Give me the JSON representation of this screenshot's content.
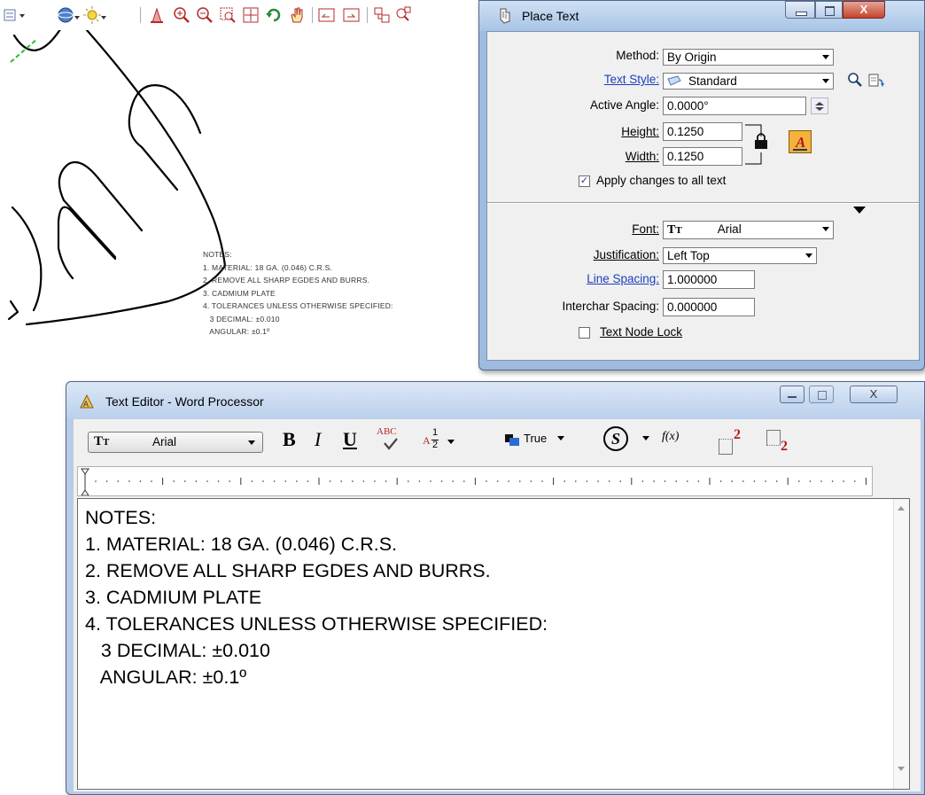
{
  "drawing": {
    "notes": [
      "NOTES:",
      "1. MATERIAL: 18 GA. (0.046) C.R.S.",
      "2. REMOVE ALL SHARP EGDES AND BURRS.",
      "3. CADMIUM PLATE",
      "4. TOLERANCES UNLESS OTHERWISE SPECIFIED:",
      "   3 DECIMAL: ±0.010",
      "   ANGULAR: ±0.1º"
    ]
  },
  "main_toolbar": {
    "icons": [
      "view-attributes-icon",
      "levels-icon",
      "lighting-icon",
      "fit-view-icon",
      "zoom-in-icon",
      "zoom-out-icon",
      "window-area-icon",
      "fit-icon",
      "rotate-icon",
      "pan-icon",
      "previous-view-icon",
      "next-view-icon",
      "copy-view-icon",
      "clip-icon"
    ]
  },
  "place_text": {
    "title": "Place Text",
    "method_label": "Method:",
    "method_value": "By Origin",
    "text_style_label": "Text Style:",
    "text_style_value": "Standard",
    "active_angle_label": "Active Angle:",
    "active_angle_value": "0.0000°",
    "height_label": "Height:",
    "height_value": "0.1250",
    "width_label": "Width:",
    "width_value": "0.1250",
    "apply_changes_label": "Apply changes to all text",
    "apply_changes_checked": true,
    "font_label": "Font:",
    "font_value": "Arial",
    "justification_label": "Justification:",
    "justification_value": "Left Top",
    "line_spacing_label": "Line Spacing:",
    "line_spacing_value": "1.000000",
    "interchar_spacing_label": "Interchar Spacing:",
    "interchar_spacing_value": "0.000000",
    "text_node_lock_label": "Text Node Lock",
    "text_node_lock_checked": false,
    "close_glyph": "X"
  },
  "text_editor": {
    "title": "Text Editor - Word Processor",
    "font_value": "Arial",
    "bold_label": "B",
    "italic_label": "I",
    "underline_label": "U",
    "spell_label": "ABC",
    "fraction_a": "A",
    "fraction_num": "1",
    "fraction_den": "2",
    "true_label": "True",
    "symbol_label": "S",
    "fx_label": "f(x)",
    "sup_label": "2",
    "sub_label": "2",
    "close_glyph": "X",
    "lines": [
      "NOTES:",
      "1. MATERIAL: 18 GA. (0.046) C.R.S.",
      "2. REMOVE ALL SHARP EGDES AND BURRS.",
      "3. CADMIUM PLATE",
      "4. TOLERANCES UNLESS OTHERWISE SPECIFIED:",
      "   3 DECIMAL: ±0.010",
      "   ANGULAR: ±0.1º"
    ]
  },
  "colors": {
    "link_blue": "#1a3fbf",
    "window_frame": "#a8c4e6",
    "close_red": "#c5432b"
  }
}
